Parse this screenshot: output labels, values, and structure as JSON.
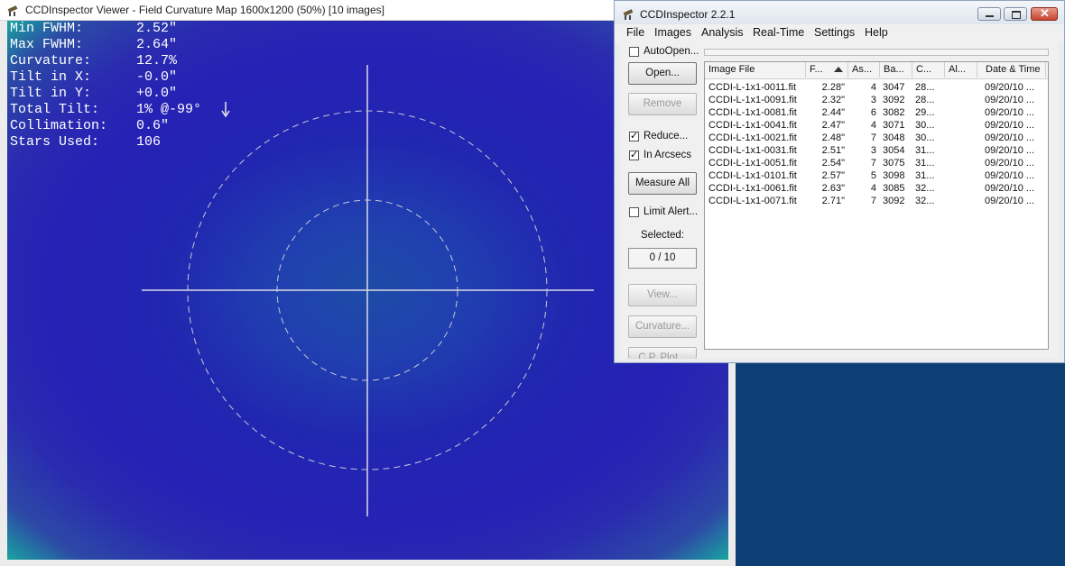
{
  "viewer": {
    "title": "CCDInspector Viewer - Field Curvature Map 1600x1200 (50%)  [10 images]",
    "stats": [
      {
        "label": "Min FWHM:",
        "value": "2.52\""
      },
      {
        "label": "Max FWHM:",
        "value": "2.64\""
      },
      {
        "label": "Curvature:",
        "value": "12.7%"
      },
      {
        "label": "Tilt in X:",
        "value": "-0.0\""
      },
      {
        "label": "Tilt in Y:",
        "value": "+0.0\""
      },
      {
        "label": "Total Tilt:",
        "value": "1% @-99°"
      },
      {
        "label": "Collimation:",
        "value": "0.6\""
      },
      {
        "label": "Stars Used:",
        "value": "106"
      }
    ]
  },
  "inspector": {
    "title": "CCDInspector 2.2.1",
    "menu": [
      "File",
      "Images",
      "Analysis",
      "Real-Time",
      "Settings",
      "Help"
    ],
    "autoopen_label": "AutoOpen...",
    "autoopen_checked": false,
    "open_button": "Open...",
    "remove_button": "Remove",
    "reduce_label": "Reduce...",
    "reduce_checked": true,
    "arcsecs_label": "In Arcsecs",
    "arcsecs_checked": true,
    "measure_all_button": "Measure All",
    "limit_alert_label": "Limit Alert...",
    "limit_alert_checked": false,
    "selected_label": "Selected:",
    "selected_value": "0 / 10",
    "view_button": "View...",
    "curvature_button": "Curvature...",
    "cutoff_button": "C.P. Plot...",
    "columns": [
      "Image File",
      "F...",
      "As...",
      "Ba...",
      "C...",
      "Al...",
      "Date & Time"
    ],
    "rows": [
      [
        "CCDI-L-1x1-0011.fit",
        "2.28\"",
        "4",
        "3047",
        "28...",
        "",
        "09/20/10 ..."
      ],
      [
        "CCDI-L-1x1-0091.fit",
        "2.32\"",
        "3",
        "3092",
        "28...",
        "",
        "09/20/10 ..."
      ],
      [
        "CCDI-L-1x1-0081.fit",
        "2.44\"",
        "6",
        "3082",
        "29...",
        "",
        "09/20/10 ..."
      ],
      [
        "CCDI-L-1x1-0041.fit",
        "2.47\"",
        "4",
        "3071",
        "30...",
        "",
        "09/20/10 ..."
      ],
      [
        "CCDI-L-1x1-0021.fit",
        "2.48\"",
        "7",
        "3048",
        "30...",
        "",
        "09/20/10 ..."
      ],
      [
        "CCDI-L-1x1-0031.fit",
        "2.51\"",
        "3",
        "3054",
        "31...",
        "",
        "09/20/10 ..."
      ],
      [
        "CCDI-L-1x1-0051.fit",
        "2.54\"",
        "7",
        "3075",
        "31...",
        "",
        "09/20/10 ..."
      ],
      [
        "CCDI-L-1x1-0101.fit",
        "2.57\"",
        "5",
        "3098",
        "31...",
        "",
        "09/20/10 ..."
      ],
      [
        "CCDI-L-1x1-0061.fit",
        "2.63\"",
        "4",
        "3085",
        "32...",
        "",
        "09/20/10 ..."
      ],
      [
        "CCDI-L-1x1-0071.fit",
        "2.71\"",
        "7",
        "3092",
        "32...",
        "",
        "09/20/10 ..."
      ]
    ]
  },
  "colors": {
    "desktop": "#0d3e74",
    "map_outer": "#2621b5",
    "map_center": "#1e4ba6",
    "map_corner": "#1aa4a0",
    "overlay_lines": "#d9d9e6"
  }
}
